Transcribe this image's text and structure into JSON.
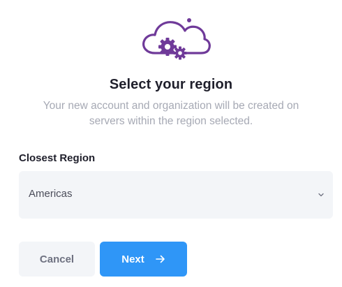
{
  "header": {
    "logo_icon": "cloud-gears-icon",
    "brand_color": "#6f3a99",
    "title": "Select your region",
    "subtitle": "Your new account and organization will be created on servers within the region selected."
  },
  "region_field": {
    "label": "Closest Region",
    "selected_value": "Americas",
    "icon": "chevron-down-icon"
  },
  "actions": {
    "cancel_label": "Cancel",
    "next_label": "Next",
    "next_icon": "arrow-right-icon",
    "accent_color": "#2f96f7"
  }
}
